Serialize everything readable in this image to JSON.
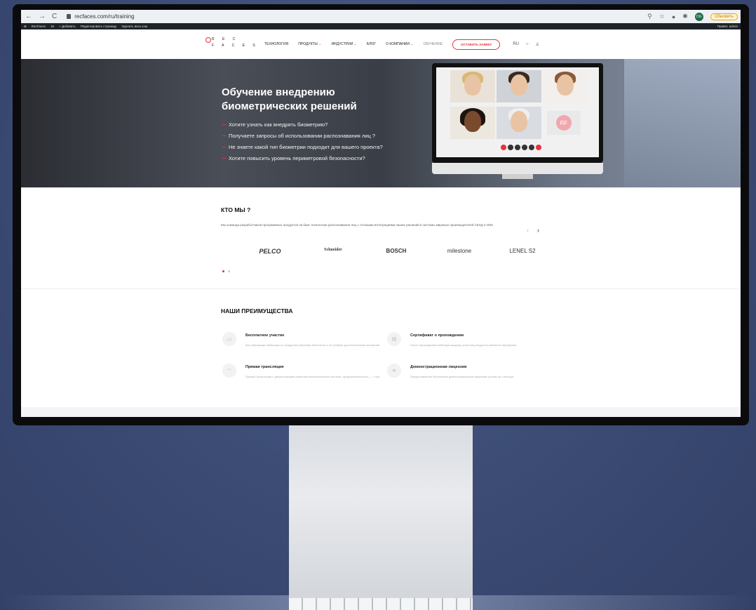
{
  "browser": {
    "url": "recfaces.com/ru/training",
    "profile_initials": "DG",
    "update_label": "Обновить"
  },
  "admin_bar": {
    "items": [
      "RecFaces",
      "16",
      "+ Добавить",
      "Редактировать страницу",
      "Удалить весь кэш"
    ],
    "greeting": "Привет, admin"
  },
  "header": {
    "logo_line1": "R E C",
    "logo_line2": "F A C E S",
    "menu": [
      "ТЕХНОЛОГИЯ",
      "ПРОДУКТЫ",
      "ИНДУСТРИИ",
      "БЛОГ",
      "О КОМПАНИИ",
      "ОБУЧЕНИЕ"
    ],
    "cta": "ОСТАВИТЬ ЗАЯВКУ",
    "lang": "RU"
  },
  "hero": {
    "title": "Обучение внедрению биометрических решений",
    "bullets": [
      "Хотите узнать как внедрять биометрию?",
      "Получаете запросы об использовании распознавания лиц ?",
      "Не знаете какой тип биометрии подходит для вашего проекта?",
      "Хотите повысить уровень периметровой безопасности?"
    ],
    "rf_badge": "RF"
  },
  "who": {
    "title": "КТО МЫ ?",
    "text": "Мы команда разработчиков программных продуктов на базе технологии распознавания лиц с готовыми интеграциями наших решений в системы мировых производителей СКУД и VMS",
    "brands": [
      "PELCO",
      "Schneider",
      "BOSCH",
      "milestone",
      "LENEL S2"
    ]
  },
  "advantages": {
    "title": "НАШИ ПРЕИМУЩЕСТВА",
    "items": [
      {
        "title": "Бесплатное участие",
        "desc": "Все обучающие вебинары по продуктам обучения бесплатны и не требуют дополнительных вложений"
      },
      {
        "title": "Сертификат о прохождении",
        "desc": "После прохождения вебинара каждому участнику выдается именной сертификат"
      },
      {
        "title": "Прямая трансляция",
        "desc": "Прямая трансляция с демонстрацией решения биометрической системы, продолжительность — 1 час"
      },
      {
        "title": "Демонстрационная лицензия",
        "desc": "Предоставление бесплатной демонстрационной лицензии сроком на 3 месяца"
      }
    ]
  }
}
